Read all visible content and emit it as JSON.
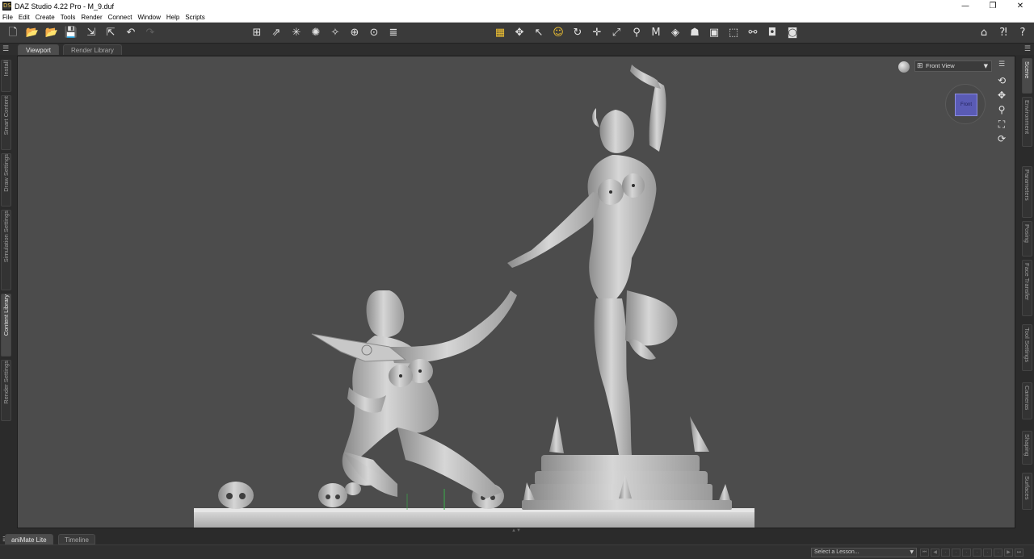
{
  "window": {
    "title": "DAZ Studio 4.22 Pro - M_9.duf",
    "app_icon_label": "DS",
    "minimize": "—",
    "maximize": "❐",
    "close": "✕"
  },
  "menubar": {
    "items": [
      "File",
      "Edit",
      "Create",
      "Tools",
      "Render",
      "Connect",
      "Window",
      "Help",
      "Scripts"
    ]
  },
  "toolbar": {
    "file_tools": [
      {
        "name": "new-scene-icon",
        "glyph": "🗋"
      },
      {
        "name": "open-icon",
        "glyph": "📂"
      },
      {
        "name": "merge-icon",
        "glyph": "📂"
      },
      {
        "name": "save-icon",
        "glyph": "💾"
      },
      {
        "name": "import-icon",
        "glyph": "⇲"
      },
      {
        "name": "export-icon",
        "glyph": "⇱"
      },
      {
        "name": "undo-icon",
        "glyph": "↶"
      },
      {
        "name": "redo-icon",
        "glyph": "↷"
      }
    ],
    "create_tools": [
      {
        "name": "create-camera-icon",
        "glyph": "⊞"
      },
      {
        "name": "create-distant-light-icon",
        "glyph": "⇗"
      },
      {
        "name": "create-point-light-icon",
        "glyph": "✳"
      },
      {
        "name": "create-spot-light-icon",
        "glyph": "✺"
      },
      {
        "name": "create-linear-light-icon",
        "glyph": "✧"
      },
      {
        "name": "create-node-icon",
        "glyph": "⊕"
      },
      {
        "name": "create-null-icon",
        "glyph": "⊙"
      },
      {
        "name": "create-group-icon",
        "glyph": "≣"
      }
    ],
    "manipulation_tools": [
      {
        "name": "node-weight-brush-icon",
        "glyph": "▦"
      },
      {
        "name": "universal-tool-icon",
        "glyph": "✥"
      },
      {
        "name": "node-selection-icon",
        "glyph": "↖"
      },
      {
        "name": "active-pose-icon",
        "glyph": "☺"
      },
      {
        "name": "rotate-tool-icon",
        "glyph": "↻"
      },
      {
        "name": "translate-tool-icon",
        "glyph": "✛"
      },
      {
        "name": "scale-tool-icon",
        "glyph": "⤢"
      },
      {
        "name": "joint-editor-icon",
        "glyph": "⚲"
      },
      {
        "name": "region-navigator-icon",
        "glyph": "M"
      },
      {
        "name": "surface-selection-icon",
        "glyph": "◈"
      },
      {
        "name": "geometry-editor-icon",
        "glyph": "☗"
      },
      {
        "name": "spot-render-icon",
        "glyph": "▣"
      },
      {
        "name": "edit-shapes-icon",
        "glyph": "⬚"
      },
      {
        "name": "transfer-utility-icon",
        "glyph": "⚯"
      },
      {
        "name": "render-settings-icon",
        "glyph": "◘"
      },
      {
        "name": "render-icon",
        "glyph": "◙"
      }
    ],
    "right_tools": [
      {
        "name": "home-icon",
        "glyph": "⌂"
      },
      {
        "name": "whats-this-icon",
        "glyph": "⁈"
      },
      {
        "name": "help-icon",
        "glyph": "?"
      }
    ]
  },
  "panel_tabs": {
    "viewport": "Viewport",
    "render_library": "Render Library"
  },
  "left_tabs": [
    "Install",
    "Smart Content",
    "Draw Settings",
    "Simulation Settings",
    "Content Library",
    "Render Settings"
  ],
  "right_tabs": [
    "Scene",
    "Environment",
    "Parameters",
    "Posing",
    "Face Transfer",
    "Tool Settings",
    "Cameras",
    "Shaping",
    "Surfaces"
  ],
  "viewport": {
    "view_name": "Front View",
    "cube_face": "Front",
    "nav_icons": [
      "orbit-icon",
      "pan-icon",
      "zoom-icon",
      "frame-icon",
      "reset-view-icon"
    ]
  },
  "bottom_tabs": {
    "animate": "aniMate Lite",
    "timeline": "Timeline"
  },
  "lesson": {
    "placeholder": "Select a Lesson...",
    "arrow": "▼"
  },
  "colors": {
    "viewport_bg": "#4c4c4c",
    "accent": "#f1c232",
    "cube": "#5a5bb5"
  }
}
